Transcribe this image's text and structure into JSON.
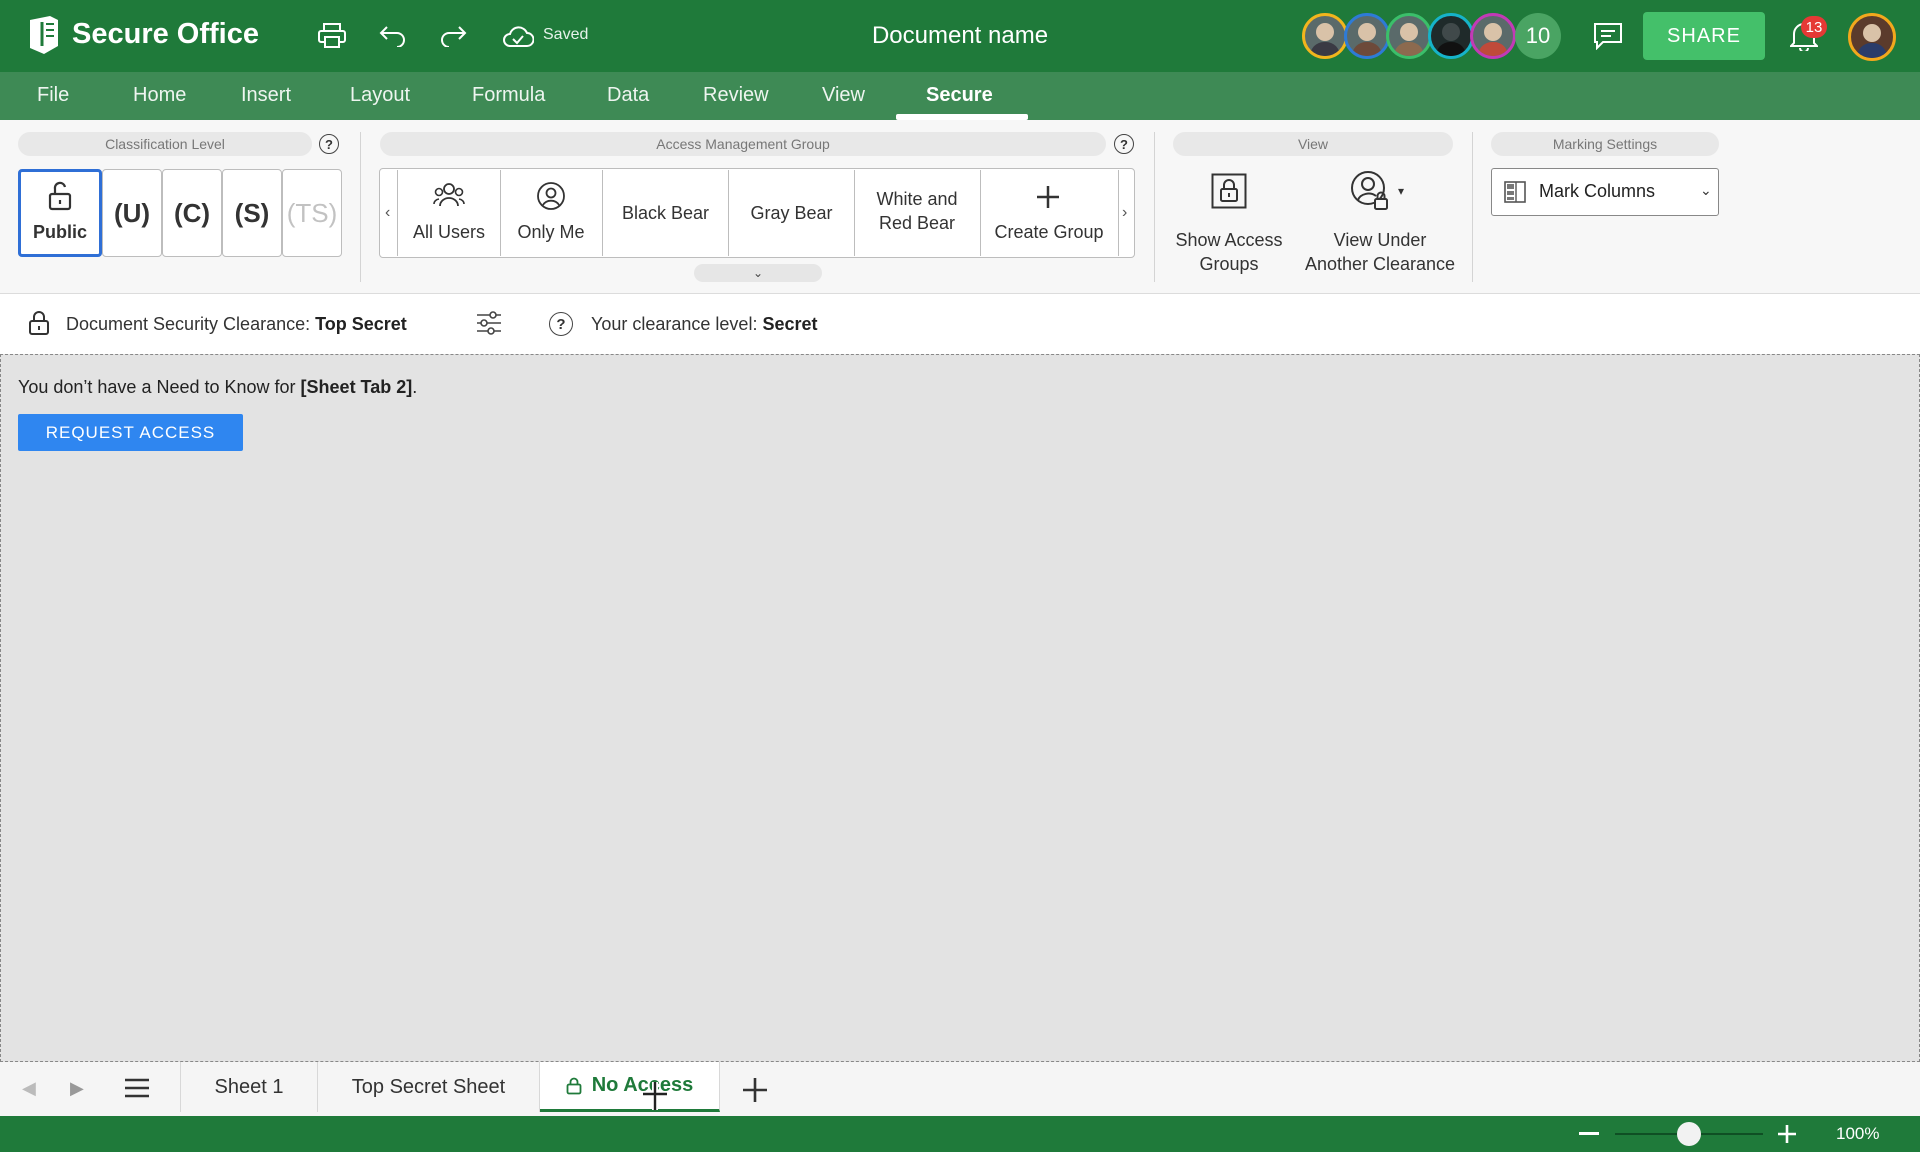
{
  "app": {
    "title": "Secure Office",
    "saved_label": "Saved",
    "document_name": "Document name"
  },
  "header": {
    "collaborators_more": "10",
    "share_label": "SHARE",
    "notification_count": "13",
    "avatar_border_colors": [
      "#f2b51d",
      "#2e7bd6",
      "#3bbf6a",
      "#16b3c9",
      "#c23ab6"
    ]
  },
  "menu": {
    "items": [
      {
        "label": "File"
      },
      {
        "label": "Home"
      },
      {
        "label": "Insert"
      },
      {
        "label": "Layout"
      },
      {
        "label": "Formula"
      },
      {
        "label": "Data"
      },
      {
        "label": "Review"
      },
      {
        "label": "View"
      },
      {
        "label": "Secure"
      }
    ],
    "active": "Secure"
  },
  "ribbon": {
    "classification": {
      "title": "Classification Level",
      "public_label": "Public",
      "levels": [
        "(U)",
        "(C)",
        "(S)",
        "(TS)"
      ]
    },
    "access_group": {
      "title": "Access Management Group",
      "all_users": "All Users",
      "only_me": "Only Me",
      "black_bear": "Black Bear",
      "gray_bear": "Gray Bear",
      "white_red_bear_1": "White and",
      "white_red_bear_2": "Red Bear",
      "create_group": "Create Group"
    },
    "view": {
      "title": "View",
      "show_access_1": "Show Access",
      "show_access_2": "Groups",
      "view_under_1": "View Under",
      "view_under_2": "Another Clearance"
    },
    "marking": {
      "title": "Marking Settings",
      "selected": "Mark Columns"
    }
  },
  "infobar": {
    "doc_clearance_prefix": "Document Security Clearance: ",
    "doc_clearance_value": "Top Secret",
    "your_clearance_prefix": "Your clearance level: ",
    "your_clearance_value": "Secret"
  },
  "content": {
    "msg_prefix": "You don’t have a Need to Know for ",
    "msg_tab": "[Sheet Tab 2]",
    "msg_suffix": ".",
    "request_label": "REQUEST ACCESS"
  },
  "sheets": {
    "tabs": [
      "Sheet 1",
      "Top Secret Sheet",
      "No Access"
    ],
    "active": "No Access"
  },
  "status": {
    "zoom": "100%",
    "zoom_level": 0.5
  },
  "colors": {
    "brand": "#1f7a3a",
    "menu": "#3e8a55",
    "share": "#44c06a",
    "primary": "#2f86f0"
  }
}
